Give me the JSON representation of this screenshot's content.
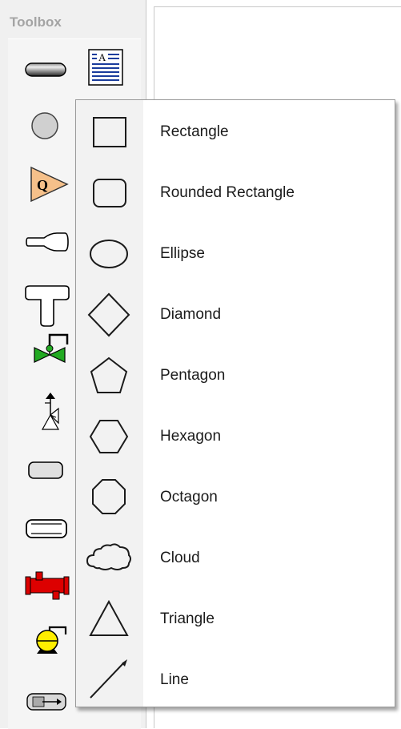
{
  "toolbox": {
    "title": "Toolbox",
    "icons": [
      "pipe-segment-icon",
      "text-block-icon",
      "circle-icon",
      "flow-meter-q-icon",
      "reducer-icon",
      "tee-fitting-icon",
      "control-valve-icon",
      "relief-valve-icon",
      "vessel-icon",
      "tank-icon",
      "heat-exchanger-icon",
      "pump-icon",
      "filter-icon"
    ],
    "text_block_label": "A",
    "flow_meter_label": "Q"
  },
  "shape_menu": {
    "items": [
      {
        "label": "Rectangle",
        "icon": "rectangle-icon"
      },
      {
        "label": "Rounded Rectangle",
        "icon": "rounded-rectangle-icon"
      },
      {
        "label": "Ellipse",
        "icon": "ellipse-icon"
      },
      {
        "label": "Diamond",
        "icon": "diamond-icon"
      },
      {
        "label": "Pentagon",
        "icon": "pentagon-icon"
      },
      {
        "label": "Hexagon",
        "icon": "hexagon-icon"
      },
      {
        "label": "Octagon",
        "icon": "octagon-icon"
      },
      {
        "label": "Cloud",
        "icon": "cloud-icon"
      },
      {
        "label": "Triangle",
        "icon": "triangle-icon"
      },
      {
        "label": "Line",
        "icon": "line-icon"
      }
    ]
  },
  "colors": {
    "valve_green": "#22aa22",
    "flow_meter_orange": "#f5c08a",
    "heat_exchanger_red": "#dd0000",
    "pump_yellow": "#ffee00"
  }
}
